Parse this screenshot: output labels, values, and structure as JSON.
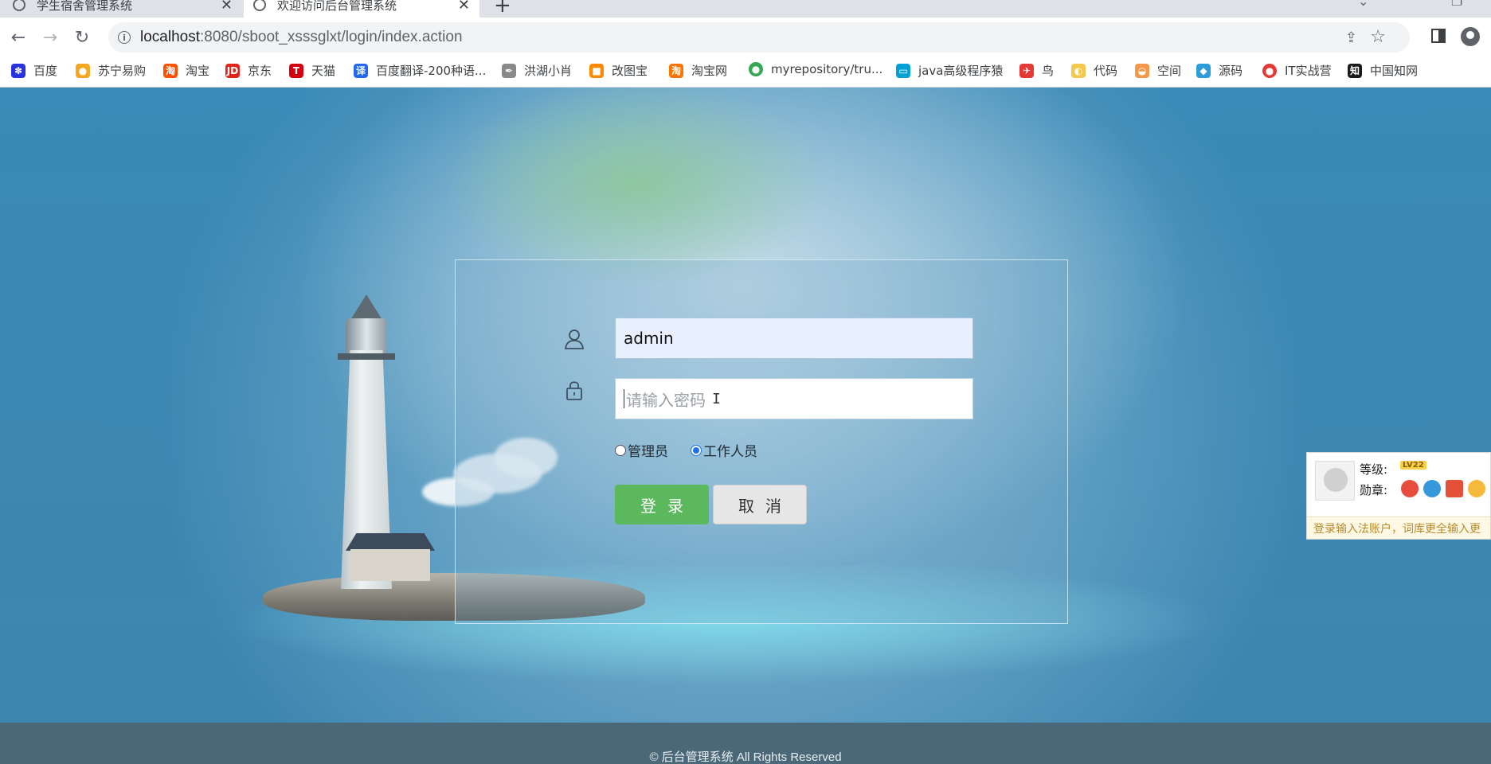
{
  "browser": {
    "tabs": [
      {
        "title": "学生宿舍管理系统",
        "active": false
      },
      {
        "title": "欢迎访问后台管理系统",
        "active": true
      }
    ],
    "url_host": "localhost",
    "url_path": ":8080/sboot_xsssglxt/login/index.action",
    "bookmarks": [
      {
        "label": "百度",
        "icon": "baidu-icon",
        "color": "#2932e1"
      },
      {
        "label": "苏宁易购",
        "icon": "suning-icon",
        "color": "#f5a623"
      },
      {
        "label": "淘宝",
        "icon": "taobao-icon",
        "color": "#ff5000"
      },
      {
        "label": "京东",
        "icon": "jd-icon",
        "color": "#e1251b"
      },
      {
        "label": "天猫",
        "icon": "tmall-icon",
        "color": "#d4000f"
      },
      {
        "label": "百度翻译-200种语...",
        "icon": "translate-icon",
        "color": "#2468f2"
      },
      {
        "label": "洪湖小肖",
        "icon": "quill-icon",
        "color": "#6b6b6b"
      },
      {
        "label": "改图宝",
        "icon": "gaitubao-icon",
        "color": "#ff8a00"
      },
      {
        "label": "淘宝网",
        "icon": "taobao-net-icon",
        "color": "#ff7300"
      },
      {
        "label": "myrepository/tru...",
        "icon": "chrome-icon",
        "color": "#34a853"
      },
      {
        "label": "java高级程序猿",
        "icon": "bilibili-icon",
        "color": "#00a1d6"
      },
      {
        "label": "鸟",
        "icon": "bird-icon",
        "color": "#e53935"
      },
      {
        "label": "代码",
        "icon": "code-icon",
        "color": "#f2c94c"
      },
      {
        "label": "空间",
        "icon": "space-icon",
        "color": "#f2994a"
      },
      {
        "label": "源码",
        "icon": "source-icon",
        "color": "#2d9cdb"
      },
      {
        "label": "IT实战营",
        "icon": "it-icon",
        "color": "#e53935"
      },
      {
        "label": "中国知网",
        "icon": "cnki-icon",
        "color": "#1a1a1a"
      }
    ]
  },
  "login": {
    "username_value": "admin",
    "password_placeholder": "请输入密码",
    "roles": [
      {
        "label": "管理员",
        "checked": false
      },
      {
        "label": "工作人员",
        "checked": true
      }
    ],
    "login_button": "登录",
    "cancel_button": "取消",
    "accent": "#5cb85c"
  },
  "ime_popup": {
    "level_label": "等级:",
    "level_badge": "LV22",
    "medal_label": "勋章:",
    "notice": "登录输入法账户，词库更全输入更"
  },
  "footer": {
    "text": "© 后台管理系统 All Rights Reserved"
  }
}
